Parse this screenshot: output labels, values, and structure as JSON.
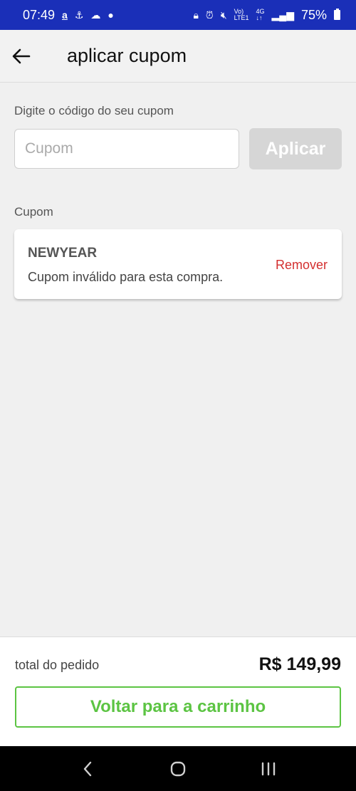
{
  "status_bar": {
    "time": "07:49",
    "battery": "75%",
    "left_icons": [
      "amazon-icon",
      "usb-debug-icon",
      "cloud-icon",
      "dot-icon"
    ],
    "right_icons": [
      "lock-icon",
      "alarm-icon",
      "mute-icon",
      "volte-icon",
      "4g-icon",
      "signal-icon",
      "battery-icon"
    ]
  },
  "header": {
    "title": "aplicar cupom"
  },
  "coupon_entry": {
    "label": "Digite o código do seu cupom",
    "placeholder": "Cupom",
    "apply_label": "Aplicar"
  },
  "applied": {
    "section_label": "Cupom",
    "code": "NEWYEAR",
    "message": "Cupom inválido para esta compra.",
    "remove_label": "Remover"
  },
  "footer": {
    "total_label": "total do pedido",
    "total_value": "R$ 149,99",
    "back_button_label": "Voltar para a carrinho"
  },
  "colors": {
    "status_bar": "#1a2fb8",
    "accent_green": "#5cc443",
    "remove_red": "#d32f2f",
    "disabled_button": "#d6d6d6"
  }
}
